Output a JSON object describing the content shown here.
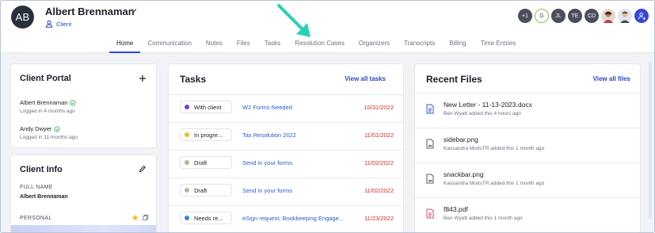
{
  "header": {
    "avatar_initials": "AB",
    "client_name": "Albert Brennaman",
    "client_type": "Client",
    "tabs": [
      {
        "label": "Home",
        "active": true
      },
      {
        "label": "Communication"
      },
      {
        "label": "Notes"
      },
      {
        "label": "Files"
      },
      {
        "label": "Tasks"
      },
      {
        "label": "Resolution Cases"
      },
      {
        "label": "Organizers"
      },
      {
        "label": "Transcripts"
      },
      {
        "label": "Billing"
      },
      {
        "label": "Time Entries"
      }
    ],
    "team_avatars": [
      "+1",
      "G",
      "JL",
      "TE",
      "CD"
    ]
  },
  "client_portal": {
    "title": "Client Portal",
    "users": [
      {
        "name": "Albert Brennaman",
        "last_login": "Logged in 4 months ago"
      },
      {
        "name": "Andy Dwyer",
        "last_login": "Logged in 11 months ago"
      }
    ]
  },
  "client_info": {
    "title": "Client Info",
    "full_name_label": "FULL NAME",
    "full_name_value": "Albert Brennaman",
    "personal_label": "PERSONAL"
  },
  "tasks": {
    "title": "Tasks",
    "view_all": "View all tasks",
    "rows": [
      {
        "status": "With client",
        "status_color": "#7c3aed",
        "name": "W2 Forms Needed",
        "date": "10/31/2022"
      },
      {
        "status": "In progre...",
        "status_color": "#e6c521",
        "name": "Tax Resolution 2022",
        "date": "11/01/2022"
      },
      {
        "status": "Draft",
        "status_color": "#bfae9e",
        "name": "Send in your forms",
        "date": "11/02/2022"
      },
      {
        "status": "Draft",
        "status_color": "#bfae9e",
        "name": "Send in your forms",
        "date": "11/02/2022"
      },
      {
        "status": "Needs re...",
        "status_color": "#2f8be6",
        "name": "eSign request: Bookkeeping Engage...",
        "date": "11/23/2022"
      }
    ]
  },
  "recent_files": {
    "title": "Recent Files",
    "view_all": "View all files",
    "files": [
      {
        "name": "New Letter - 11-13-2023.docx",
        "meta": "Ben Wyatt added this 4 hours ago",
        "icon": "doc-file-icon",
        "color": "#2f5bd0"
      },
      {
        "name": "sidebar.png",
        "meta": "Kassandra ModsTR added this 1 month ago",
        "icon": "image-file-icon",
        "color": "#555b66"
      },
      {
        "name": "snackbar.png",
        "meta": "Kassandra ModsTR added this 1 month ago",
        "icon": "image-file-icon",
        "color": "#555b66"
      },
      {
        "name": "f843.pdf",
        "meta": "Ben Wyatt added this 1 month ago",
        "icon": "pdf-file-icon",
        "color": "#e0446a"
      }
    ]
  },
  "colors": {
    "accent": "#3347d6",
    "link": "#2f44c2",
    "overdue": "#d0302d",
    "arrow": "#2ad1b5"
  }
}
